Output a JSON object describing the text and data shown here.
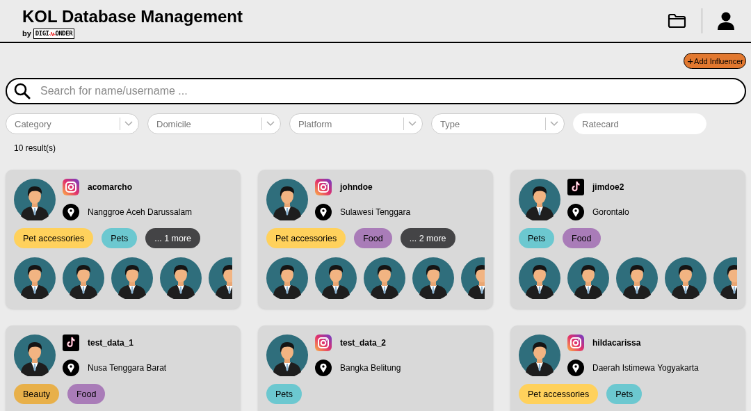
{
  "header": {
    "title": "KOL Database Management",
    "byline": "by",
    "logo_left": "DIGI",
    "logo_right": "ONDER"
  },
  "add_button": {
    "icon": "+",
    "label": "Add Influencer"
  },
  "search": {
    "placeholder": "Search for name/username ..."
  },
  "filters": [
    {
      "kind": "select",
      "placeholder": "Category"
    },
    {
      "kind": "select",
      "placeholder": "Domicile"
    },
    {
      "kind": "select",
      "placeholder": "Platform"
    },
    {
      "kind": "select",
      "placeholder": "Type"
    },
    {
      "kind": "input",
      "placeholder": "Ratecard"
    }
  ],
  "result_count": "10 result(s)",
  "cards": [
    {
      "kind": "instagram",
      "username": "acomarcho",
      "location": "Nanggroe Aceh Darussalam",
      "tags": [
        {
          "kind": "category",
          "label": "Pet accessories",
          "color": "#ffd15c"
        },
        {
          "kind": "category",
          "label": "Pets",
          "color": "#6cc8d0"
        },
        {
          "kind": "more",
          "label": "... 1 more",
          "color": "#444446"
        }
      ]
    },
    {
      "kind": "instagram",
      "username": "johndoe",
      "location": "Sulawesi Tenggara",
      "tags": [
        {
          "kind": "category",
          "label": "Pet accessories",
          "color": "#ffd15c"
        },
        {
          "kind": "category",
          "label": "Food",
          "color": "#a97cb8"
        },
        {
          "kind": "more",
          "label": "... 2 more",
          "color": "#444446"
        }
      ]
    },
    {
      "kind": "tiktok",
      "username": "jimdoe2",
      "location": "Gorontalo",
      "tags": [
        {
          "kind": "category",
          "label": "Pets",
          "color": "#6cc8d0"
        },
        {
          "kind": "category",
          "label": "Food",
          "color": "#a97cb8"
        }
      ]
    },
    {
      "kind": "tiktok",
      "username": "test_data_1",
      "location": "Nusa Tenggara Barat",
      "tags": [
        {
          "kind": "category",
          "label": "Beauty",
          "color": "#e8b04a"
        },
        {
          "kind": "category",
          "label": "Food",
          "color": "#a97cb8"
        }
      ]
    },
    {
      "kind": "instagram",
      "username": "test_data_2",
      "location": "Bangka Belitung",
      "tags": [
        {
          "kind": "category",
          "label": "Pets",
          "color": "#6cc8d0"
        }
      ]
    },
    {
      "kind": "instagram",
      "username": "hildacarissa",
      "location": "Daerah Istimewa Yogyakarta",
      "tags": [
        {
          "kind": "category",
          "label": "Pet accessories",
          "color": "#ffd15c"
        },
        {
          "kind": "category",
          "label": "Pets",
          "color": "#6cc8d0"
        }
      ]
    }
  ]
}
